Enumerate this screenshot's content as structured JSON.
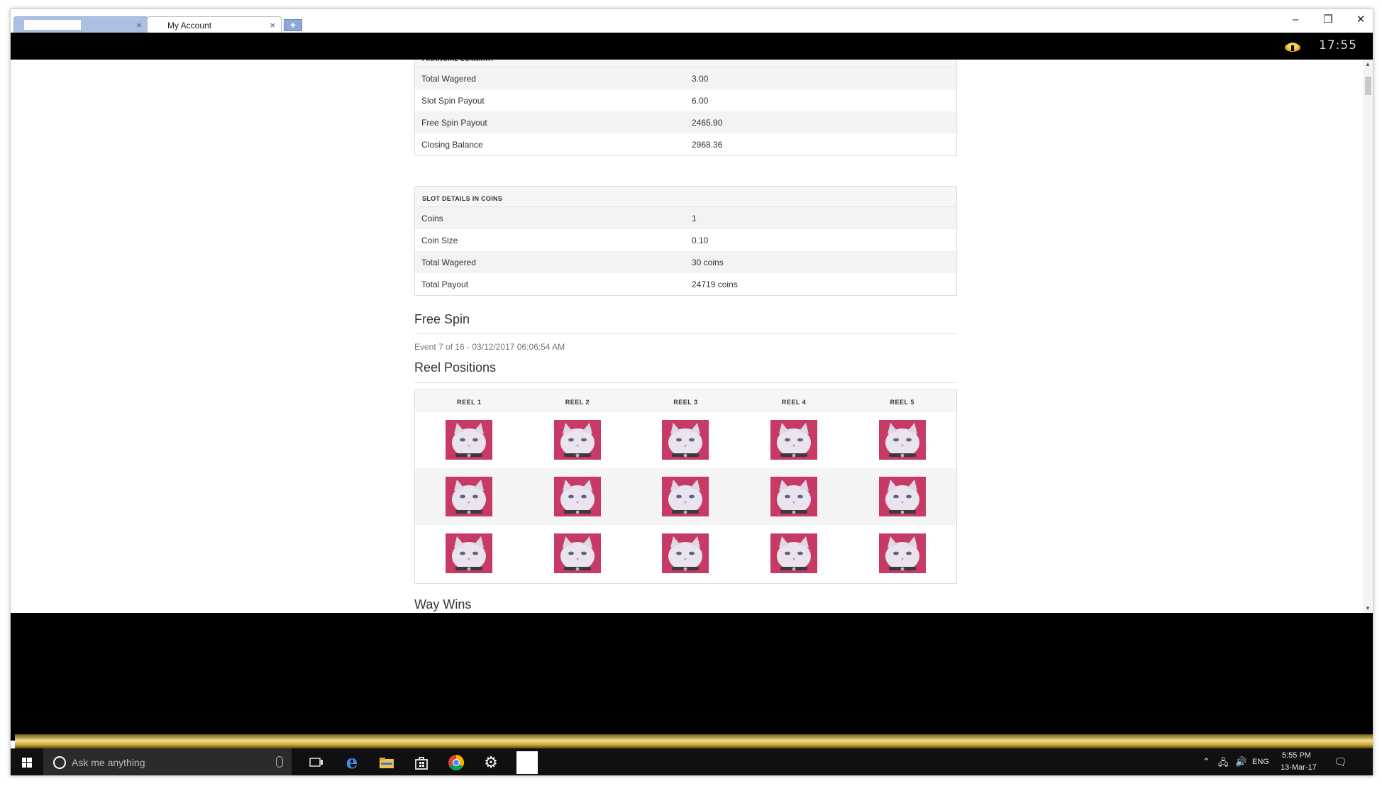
{
  "browser": {
    "tabs": [
      {
        "label": "",
        "active": false
      },
      {
        "label": "My Account",
        "active": true
      }
    ],
    "new_tab_label": "+"
  },
  "topbar": {
    "clock": "17:55"
  },
  "financial_summary": {
    "heading": "FINANCIAL SUMMARY",
    "rows": [
      {
        "label": "Total Wagered",
        "value": "3.00"
      },
      {
        "label": "Slot Spin Payout",
        "value": "6.00"
      },
      {
        "label": "Free Spin Payout",
        "value": "2465.90"
      },
      {
        "label": "Closing Balance",
        "value": "2968.36"
      }
    ]
  },
  "slot_details": {
    "heading": "SLOT DETAILS IN COINS",
    "rows": [
      {
        "label": "Coins",
        "value": "1"
      },
      {
        "label": "Coin Size",
        "value": "0.10"
      },
      {
        "label": "Total Wagered",
        "value": "30 coins"
      },
      {
        "label": "Total Payout",
        "value": "24719 coins"
      }
    ]
  },
  "free_spin": {
    "title": "Free Spin",
    "event": "Event 7 of 16 - 03/12/2017 06:06:54 AM"
  },
  "reel_positions": {
    "title": "Reel Positions",
    "columns": [
      "REEL 1",
      "REEL 2",
      "REEL 3",
      "REEL 4",
      "REEL 5"
    ],
    "rows": 3,
    "symbol": "white-cat"
  },
  "way_wins": {
    "title": "Way Wins"
  },
  "taskbar": {
    "search_placeholder": "Ask me anything",
    "tray": {
      "language": "ENG",
      "time": "5:55 PM",
      "date": "13-Mar-17"
    }
  },
  "colors": {
    "gold_bar": "#e6cc6a",
    "tab_active_border": "#9ab3d6",
    "symbol_bg": "#c73a66"
  }
}
